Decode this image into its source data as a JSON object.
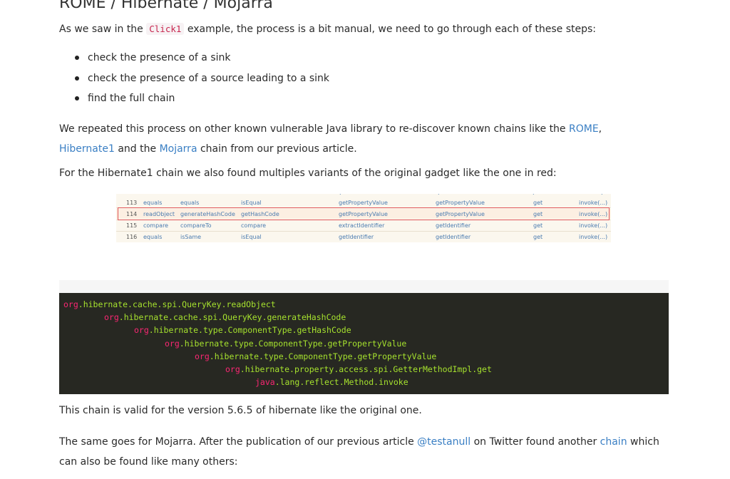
{
  "heading": "ROME / Hibernate / Mojarra",
  "intro": {
    "before": "As we saw in the ",
    "code": "Click1",
    "after": " example, the process is a bit manual, we need to go through each of these steps:"
  },
  "steps": [
    "check the presence of a sink",
    "check the presence of a source leading to a sink",
    "find the full chain"
  ],
  "repeat_para": {
    "before": "We repeated this process on other known vulnerable Java library to re-discover known chains like the ",
    "link_rome": "ROME",
    "sep1": ", ",
    "link_hibernate": "Hibernate1",
    "mid": " and the ",
    "link_mojarra": "Mojarra",
    "after": " chain from our previous article."
  },
  "variants_para": "For the Hibernate1 chain we also found multiples variants of the original gadget like the one in red:",
  "table": {
    "rows": [
      {
        "num": "113",
        "c1": "equals",
        "c2": "equals",
        "c3": "isEqual",
        "c4": "getPropertyValue",
        "c5": "getPropertyValue",
        "c6": "get",
        "c7": "invoke(...)"
      },
      {
        "num": "114",
        "c1": "readObject",
        "c2": "generateHashCode",
        "c3": "getHashCode",
        "c4": "getPropertyValue",
        "c5": "getPropertyValue",
        "c6": "get",
        "c7": "invoke(...)"
      },
      {
        "num": "115",
        "c1": "compare",
        "c2": "compareTo",
        "c3": "compare",
        "c4": "extractIdentifier",
        "c5": "getIdentifier",
        "c6": "get",
        "c7": "invoke(...)"
      },
      {
        "num": "116",
        "c1": "equals",
        "c2": "isSame",
        "c3": "isEqual",
        "c4": "getIdentifier",
        "c5": "getIdentifier",
        "c6": "get",
        "c7": "invoke(...)"
      }
    ]
  },
  "code": [
    {
      "pkg": "org",
      "rest": ".hibernate.cache.spi.QueryKey.readObject"
    },
    {
      "pkg": "org",
      "rest": ".hibernate.cache.spi.QueryKey.generateHashCode"
    },
    {
      "pkg": "org",
      "rest": ".hibernate.type.ComponentType.getHashCode"
    },
    {
      "pkg": "org",
      "rest": ".hibernate.type.ComponentType.getPropertyValue"
    },
    {
      "pkg": "org",
      "rest": ".hibernate.type.ComponentType.getPropertyValue"
    },
    {
      "pkg": "org",
      "rest": ".hibernate.property.access.spi.GetterMethodImpl.get"
    },
    {
      "pkg": "java",
      "rest": ".lang.reflect.Method.invoke"
    }
  ],
  "valid_para": "This chain is valid for the version 5.6.5 of hibernate like the original one.",
  "mojarra_para": {
    "before": "The same goes for Mojarra. After the publication of our previous article ",
    "link_user": "@testanull",
    "mid": " on Twitter found another ",
    "link_chain": "chain",
    "after": " which can also be found like many others:"
  },
  "colors": {
    "link": "#3a7fc4",
    "code_bg": "#272822",
    "code_pkg": "#f92672",
    "code_text": "#a6e22e",
    "highlight": "#e0575a"
  }
}
